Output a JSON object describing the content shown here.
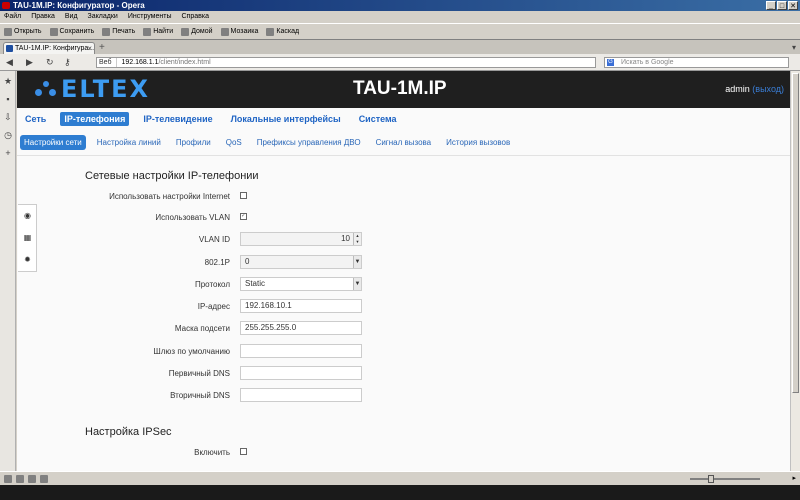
{
  "window": {
    "title": "TAU-1M.IP: Конфигуратор - Opera",
    "controls": [
      "_",
      "□",
      "✕"
    ]
  },
  "menu": [
    "Файл",
    "Правка",
    "Вид",
    "Закладки",
    "Инструменты",
    "Справка"
  ],
  "toolbar": [
    "Открыть",
    "Сохранить",
    "Печать",
    "Найти",
    "Домой",
    "Мозаика",
    "Каскад"
  ],
  "tab": {
    "title": "TAU-1M.IP: Конфигура..."
  },
  "address": {
    "badge": "Веб",
    "host": "192.168.1.1",
    "path": "/client/index.html",
    "search_placeholder": "Искать в Google"
  },
  "header": {
    "logo": "ELTEX",
    "device": "TAU-1M.IP",
    "user": "admin",
    "logout": "(выход)"
  },
  "mainnav": [
    {
      "label": "Сеть",
      "active": false
    },
    {
      "label": "IP-телефония",
      "active": true
    },
    {
      "label": "IP-телевидение",
      "active": false
    },
    {
      "label": "Локальные интерфейсы",
      "active": false
    },
    {
      "label": "Система",
      "active": false
    }
  ],
  "subnav": [
    {
      "label": "Настройки сети",
      "active": true
    },
    {
      "label": "Настройка линий",
      "active": false
    },
    {
      "label": "Профили",
      "active": false
    },
    {
      "label": "QoS",
      "active": false
    },
    {
      "label": "Префиксы управления ДВО",
      "active": false
    },
    {
      "label": "Сигнал вызова",
      "active": false
    },
    {
      "label": "История вызовов",
      "active": false
    }
  ],
  "network_section": {
    "title": "Сетевые настройки IP-телефонии",
    "use_internet_label": "Использовать настройки Internet",
    "use_internet_checked": false,
    "use_vlan_label": "Использовать VLAN",
    "use_vlan_checked": true,
    "vlan_id_label": "VLAN ID",
    "vlan_id_value": "10",
    "p8021_label": "802.1P",
    "p8021_value": "0",
    "protocol_label": "Протокол",
    "protocol_value": "Static",
    "ip_label": "IP-адрес",
    "ip_value": "192.168.10.1",
    "mask_label": "Маска подсети",
    "mask_value": "255.255.255.0",
    "gateway_label": "Шлюз по умолчанию",
    "gateway_value": "",
    "dns1_label": "Первичный DNS",
    "dns1_value": "",
    "dns2_label": "Вторичный DNS",
    "dns2_value": ""
  },
  "ipsec_section": {
    "title": "Настройка IPSec",
    "enable_label": "Включить",
    "enable_checked": false
  }
}
